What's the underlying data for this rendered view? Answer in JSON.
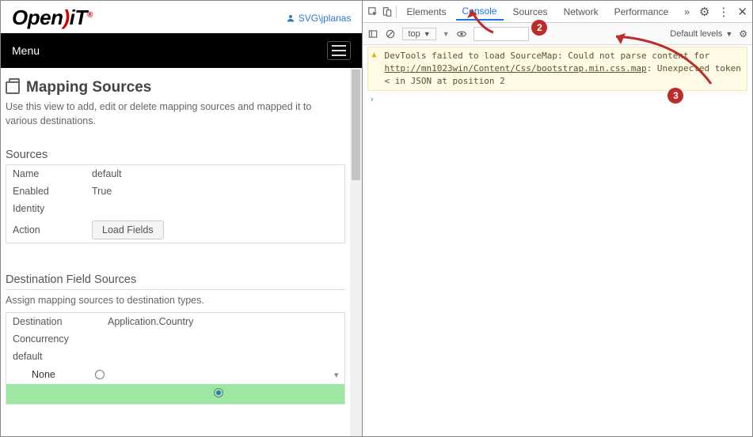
{
  "header": {
    "logo_open": "Open",
    "logo_it": "iT",
    "logo_reg": "®",
    "user": "SVG\\jplanas"
  },
  "menu": {
    "label": "Menu"
  },
  "page": {
    "title": "Mapping Sources",
    "desc": "Use this view to add, edit or delete mapping sources and mapped it to various destinations."
  },
  "sources": {
    "heading": "Sources",
    "rows": {
      "name_k": "Name",
      "name_v": "default",
      "enabled_k": "Enabled",
      "enabled_v": "True",
      "identity_k": "Identity",
      "identity_v": "",
      "action_k": "Action"
    },
    "button": "Load Fields"
  },
  "dest": {
    "heading": "Destination Field Sources",
    "desc": "Assign mapping sources to destination types.",
    "dest_k": "Destination",
    "dest_v": "Application.Country",
    "conc_k": "Concurrency",
    "default_k": "default",
    "none_label": "None"
  },
  "devtools": {
    "tabs": {
      "elements": "Elements",
      "console": "Console",
      "sources": "Sources",
      "network": "Network",
      "performance": "Performance"
    },
    "ctx": "top",
    "filter_ph": "",
    "levels": "Default levels",
    "warn_pre": "DevTools failed to load SourceMap: Could not parse content for ",
    "warn_link": "http://mn1023win/Content/Css/bootstrap.min.css.map",
    "warn_post": ": Unexpected token < in JSON at position 2"
  },
  "badges": {
    "b2": "2",
    "b3": "3"
  }
}
